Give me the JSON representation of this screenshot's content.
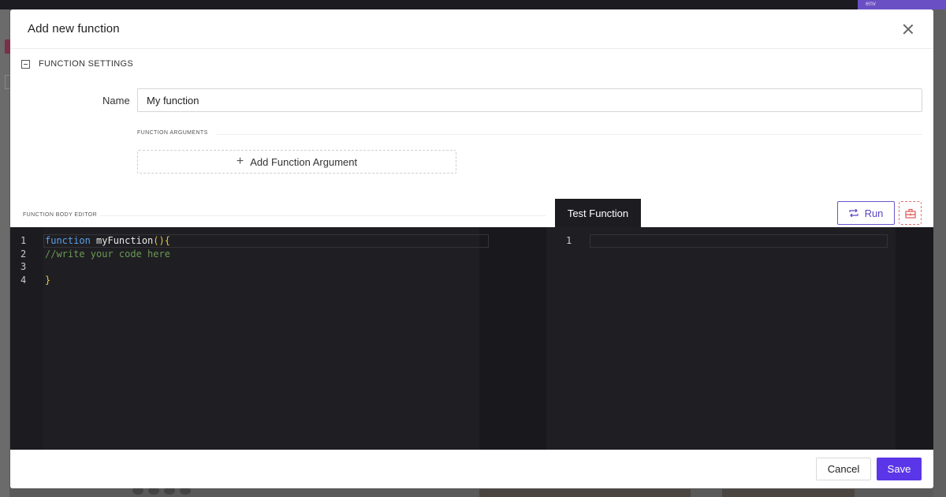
{
  "background": {
    "env_label": "env"
  },
  "modal": {
    "title": "Add new function",
    "close_icon": "close-icon"
  },
  "function_settings": {
    "section_label": "FUNCTION SETTINGS",
    "collapse_icon": "minus-square-icon",
    "name_label": "Name",
    "name_value": "My function",
    "arguments_label": "FUNCTION ARGUMENTS",
    "add_argument_label": "Add Function Argument",
    "add_argument_icon": "plus-icon"
  },
  "body_editor": {
    "label": "FUNCTION BODY EDITOR",
    "line_numbers": [
      "1",
      "2",
      "3",
      "4"
    ],
    "lines": {
      "line1_keyword": "function",
      "line1_name": " myFunction",
      "line1_parens": "(){",
      "line2_comment": "//write your code here",
      "line4_brace": "}"
    }
  },
  "test_panel": {
    "tab_label": "Test Function",
    "run_label": "Run",
    "run_icon": "loop-icon",
    "clear_icon": "toolbox-icon",
    "line_numbers": [
      "1"
    ]
  },
  "footer": {
    "cancel_label": "Cancel",
    "save_label": "Save"
  },
  "colors": {
    "accent": "#5b36e8",
    "run_border": "#6b55c9",
    "editor_bg": "#1f1e22",
    "keyword": "#5aa0e6",
    "comment": "#6a9955",
    "paren": "#e5c84a",
    "clear_button": "#e07070"
  }
}
